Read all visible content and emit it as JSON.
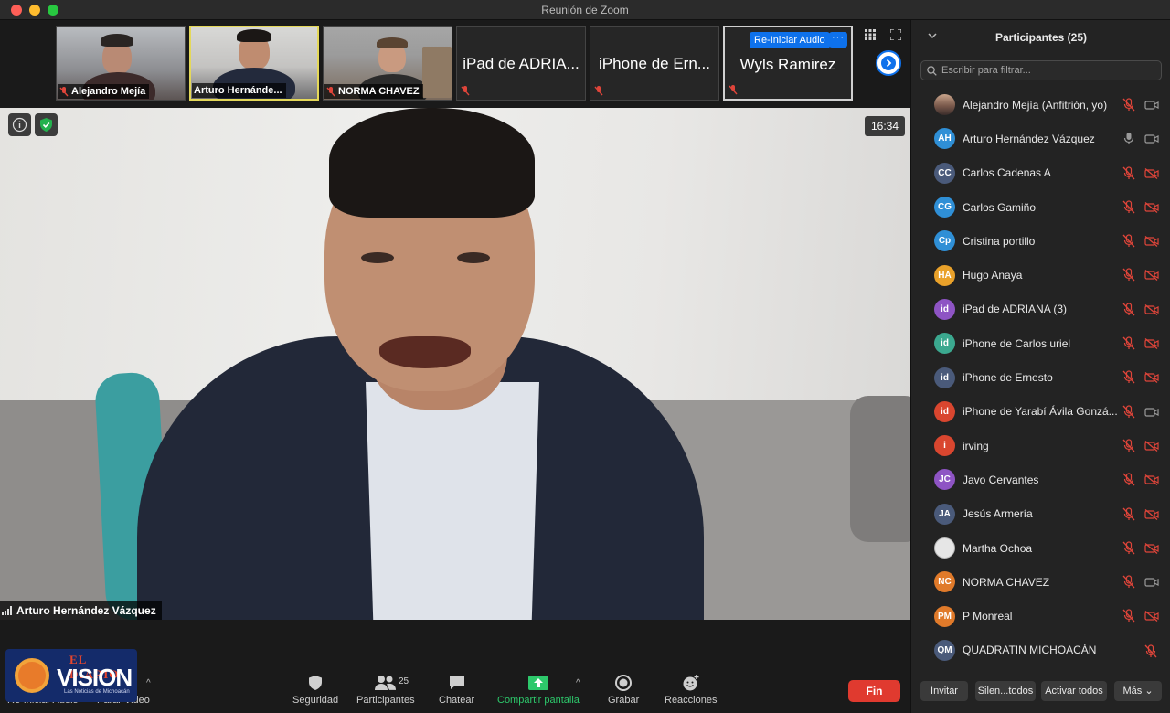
{
  "window": {
    "title": "Reunión de Zoom"
  },
  "thumbnails": [
    {
      "name": "Alejandro Mejía",
      "kind": "video"
    },
    {
      "name": "Arturo Hernánde...",
      "kind": "video"
    },
    {
      "name": "NORMA CHAVEZ",
      "kind": "video"
    },
    {
      "name": "iPad de ADRIA...",
      "kind": "text"
    },
    {
      "name": "iPhone de Ern...",
      "kind": "text"
    },
    {
      "name": "Wyls Ramirez",
      "kind": "text"
    }
  ],
  "thumb_overlay": {
    "reaudio_label": "Re-Iniciar Audio",
    "more_label": "···"
  },
  "main_video": {
    "speaker": "Arturo Hernández Vázquez",
    "timer": "16:34"
  },
  "toolbar": {
    "reaudio": "Re-Iniciar Audio",
    "stop_video": "Parar Video",
    "security": "Seguridad",
    "participants": "Participantes",
    "participants_count": "25",
    "chat": "Chatear",
    "share": "Compartir pantalla",
    "record": "Grabar",
    "reactions": "Reacciones",
    "end": "Fin"
  },
  "watermark": {
    "top": "EL DIARIO",
    "main": "VISION",
    "tag": "Las Noticias de Michoacán"
  },
  "panel": {
    "title": "Participantes (25)",
    "filter_placeholder": "Escribir para filtrar...",
    "participants": [
      {
        "initials": "",
        "name": "Alejandro Mejía (Anfitrión, yo)",
        "color": "#8a7a6a",
        "mic": "muted",
        "cam": "on"
      },
      {
        "initials": "AH",
        "name": "Arturo Hernández Vázquez",
        "color": "#2f8fd6",
        "mic": "on",
        "cam": "on"
      },
      {
        "initials": "CC",
        "name": "Carlos Cadenas A",
        "color": "#4a5a7a",
        "mic": "muted",
        "cam": "off"
      },
      {
        "initials": "CG",
        "name": "Carlos Gamiño",
        "color": "#2f8fd6",
        "mic": "muted",
        "cam": "off"
      },
      {
        "initials": "Cp",
        "name": "Cristina portillo",
        "color": "#2f8fd6",
        "mic": "muted",
        "cam": "off"
      },
      {
        "initials": "HA",
        "name": "Hugo Anaya",
        "color": "#e9a12a",
        "mic": "muted",
        "cam": "off"
      },
      {
        "initials": "id",
        "name": "iPad de ADRIANA (3)",
        "color": "#8e54c4",
        "mic": "muted",
        "cam": "off"
      },
      {
        "initials": "id",
        "name": "iPhone de Carlos uriel",
        "color": "#3ba88f",
        "mic": "muted",
        "cam": "off"
      },
      {
        "initials": "id",
        "name": "iPhone de Ernesto",
        "color": "#4a5a7a",
        "mic": "muted",
        "cam": "off"
      },
      {
        "initials": "id",
        "name": "iPhone de Yarabí Ávila Gonzá...",
        "color": "#d9462f",
        "mic": "muted",
        "cam": "on"
      },
      {
        "initials": "i",
        "name": "irving",
        "color": "#d9462f",
        "mic": "muted",
        "cam": "off"
      },
      {
        "initials": "JC",
        "name": "Javo Cervantes",
        "color": "#8e54c4",
        "mic": "muted",
        "cam": "off"
      },
      {
        "initials": "JA",
        "name": "Jesús Armería",
        "color": "#4a5a7a",
        "mic": "muted",
        "cam": "off"
      },
      {
        "initials": "",
        "name": "Martha Ochoa",
        "color": "#e6e6e6",
        "mic": "muted",
        "cam": "off"
      },
      {
        "initials": "NC",
        "name": "NORMA CHAVEZ",
        "color": "#e07a2a",
        "mic": "muted",
        "cam": "on"
      },
      {
        "initials": "PM",
        "name": "P Monreal",
        "color": "#e07a2a",
        "mic": "muted",
        "cam": "off"
      },
      {
        "initials": "QM",
        "name": "QUADRATIN MICHOACÁN",
        "color": "#4a5a7a",
        "mic": "none",
        "cam": "muted-only"
      }
    ],
    "buttons": {
      "invite": "Invitar",
      "mute_all": "Silen...todos",
      "unmute_all": "Activar todos",
      "more": "Más"
    }
  },
  "colors": {
    "accent": "#0e71eb",
    "end": "#e03a2f",
    "share": "#2dc86b",
    "muted": "#e0453a"
  }
}
